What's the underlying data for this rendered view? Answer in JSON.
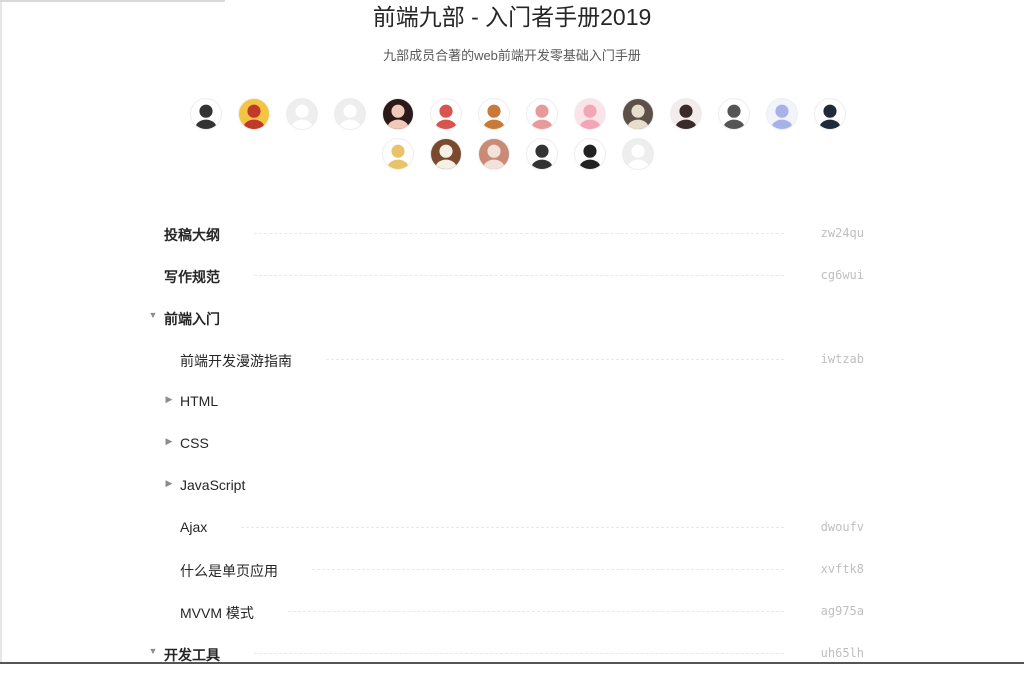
{
  "header": {
    "title": "前端九部 - 入门者手册2019",
    "subtitle": "九部成员合著的web前端开发零基础入门手册"
  },
  "avatars": {
    "row1": [
      {
        "name": "member-avatar",
        "bg": "#ffffff",
        "fg": "#333333"
      },
      {
        "name": "member-avatar",
        "bg": "#f4c542",
        "fg": "#c0392b"
      },
      {
        "name": "member-avatar",
        "bg": "#eeeeee",
        "fg": "#ffffff"
      },
      {
        "name": "member-avatar",
        "bg": "#eeeeee",
        "fg": "#ffffff"
      },
      {
        "name": "member-avatar",
        "bg": "#2b1a1a",
        "fg": "#f2c9b8"
      },
      {
        "name": "member-avatar",
        "bg": "#ffffff",
        "fg": "#d9534f"
      },
      {
        "name": "member-avatar",
        "bg": "#ffffff",
        "fg": "#c87a3a"
      },
      {
        "name": "member-avatar",
        "bg": "#ffffff",
        "fg": "#e89a9a"
      },
      {
        "name": "member-avatar",
        "bg": "#fbe3ea",
        "fg": "#f2a6b6"
      },
      {
        "name": "member-avatar",
        "bg": "#5b5148",
        "fg": "#e8dccd"
      },
      {
        "name": "member-avatar",
        "bg": "#f3ecec",
        "fg": "#3a2a2a"
      },
      {
        "name": "member-avatar",
        "bg": "#ffffff",
        "fg": "#555555"
      },
      {
        "name": "member-avatar",
        "bg": "#f2f4fb",
        "fg": "#a7b3e8"
      },
      {
        "name": "member-avatar",
        "bg": "#ffffff",
        "fg": "#1f2b3a"
      }
    ],
    "row2": [
      {
        "name": "member-avatar",
        "bg": "#ffffff",
        "fg": "#e8c36a"
      },
      {
        "name": "member-avatar",
        "bg": "#7a4a2e",
        "fg": "#f5f0e6"
      },
      {
        "name": "member-avatar",
        "bg": "#c98b78",
        "fg": "#f2e2da"
      },
      {
        "name": "member-avatar",
        "bg": "#ffffff",
        "fg": "#333333"
      },
      {
        "name": "member-avatar",
        "bg": "#ffffff",
        "fg": "#222222"
      },
      {
        "name": "member-avatar",
        "bg": "#eeeeee",
        "fg": "#ffffff"
      }
    ]
  },
  "toc": [
    {
      "level": 1,
      "label": "投稿大纲",
      "slug": "zw24qu",
      "caret": ""
    },
    {
      "level": 1,
      "label": "写作规范",
      "slug": "cg6wui",
      "caret": ""
    },
    {
      "level": 1,
      "label": "前端入门",
      "slug": "",
      "caret": "▼"
    },
    {
      "level": 2,
      "label": "前端开发漫游指南",
      "slug": "iwtzab",
      "caret": ""
    },
    {
      "level": 2,
      "label": "HTML",
      "slug": "",
      "caret": "▶"
    },
    {
      "level": 2,
      "label": "CSS",
      "slug": "",
      "caret": "▶"
    },
    {
      "level": 2,
      "label": "JavaScript",
      "slug": "",
      "caret": "▶"
    },
    {
      "level": 2,
      "label": "Ajax",
      "slug": "dwoufv",
      "caret": ""
    },
    {
      "level": 2,
      "label": "什么是单页应用",
      "slug": "xvftk8",
      "caret": ""
    },
    {
      "level": 2,
      "label": "MVVM 模式",
      "slug": "ag975a",
      "caret": ""
    },
    {
      "level": 1,
      "label": "开发工具",
      "slug": "uh65lh",
      "caret": "▼"
    }
  ]
}
